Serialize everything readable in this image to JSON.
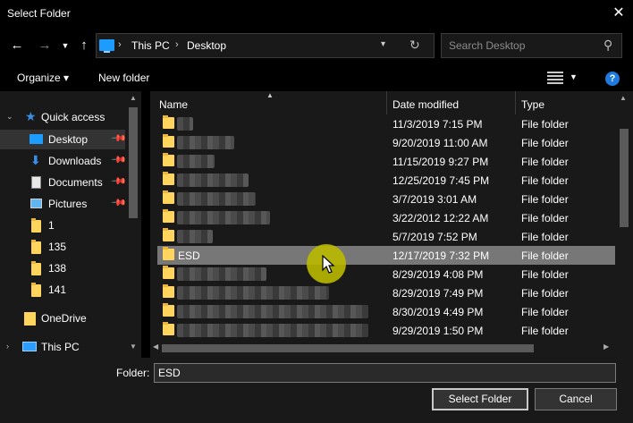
{
  "window": {
    "title": "Select Folder"
  },
  "address": {
    "crumbs": [
      "This PC",
      "Desktop"
    ]
  },
  "search": {
    "placeholder": "Search Desktop"
  },
  "toolbar": {
    "organize": "Organize",
    "new_folder": "New folder"
  },
  "nav": {
    "quick_access": "Quick access",
    "items": [
      {
        "label": "Desktop",
        "pinned": true,
        "selected": true,
        "icon": "desktop-icon"
      },
      {
        "label": "Downloads",
        "pinned": true,
        "icon": "download-icon"
      },
      {
        "label": "Documents",
        "pinned": true,
        "icon": "documents-icon"
      },
      {
        "label": "Pictures",
        "pinned": true,
        "icon": "pictures-icon"
      },
      {
        "label": "1",
        "icon": "folder-icon"
      },
      {
        "label": "135",
        "icon": "folder-icon"
      },
      {
        "label": "138",
        "icon": "folder-icon"
      },
      {
        "label": "141",
        "icon": "folder-icon"
      }
    ],
    "onedrive": "OneDrive",
    "this_pc": "This PC"
  },
  "columns": {
    "name": "Name",
    "date": "Date modified",
    "type": "Type"
  },
  "files": [
    {
      "name": "",
      "date": "11/3/2019 7:15 PM",
      "type": "File folder"
    },
    {
      "name": "",
      "date": "9/20/2019 11:00 AM",
      "type": "File folder"
    },
    {
      "name": "",
      "date": "11/15/2019 9:27 PM",
      "type": "File folder"
    },
    {
      "name": "",
      "date": "12/25/2019 7:45 PM",
      "type": "File folder"
    },
    {
      "name": "",
      "date": "3/7/2019 3:01 AM",
      "type": "File folder"
    },
    {
      "name": "",
      "date": "3/22/2012 12:22 AM",
      "type": "File folder"
    },
    {
      "name": "",
      "date": "5/7/2019 7:52 PM",
      "type": "File folder"
    },
    {
      "name": "ESD",
      "date": "12/17/2019 7:32 PM",
      "type": "File folder",
      "selected": true
    },
    {
      "name": "",
      "date": "8/29/2019 4:08 PM",
      "type": "File folder"
    },
    {
      "name": "",
      "date": "8/29/2019 7:49 PM",
      "type": "File folder"
    },
    {
      "name": "",
      "date": "8/30/2019 4:49 PM",
      "type": "File folder"
    },
    {
      "name": "",
      "date": "9/29/2019 1:50 PM",
      "type": "File folder"
    }
  ],
  "bottom": {
    "folder_label": "Folder:",
    "folder_value": "ESD",
    "select_label": "Select Folder",
    "cancel_label": "Cancel"
  },
  "colors": {
    "accent": "#1c9cff",
    "folder": "#ffd55e",
    "cursor_highlight": "#b9b900"
  }
}
